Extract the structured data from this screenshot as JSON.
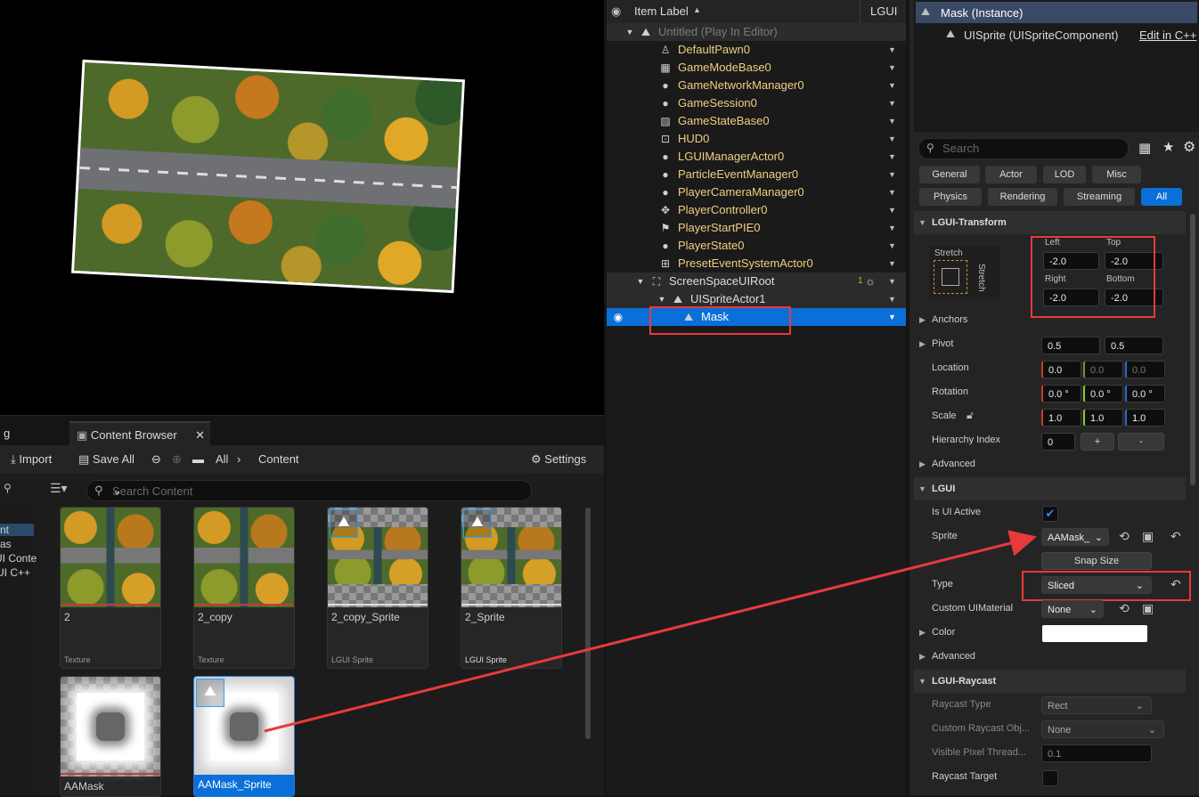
{
  "content_browser": {
    "left_tab": "g",
    "tab_label": "Content Browser",
    "toolbar": {
      "import": "Import",
      "save_all": "Save All",
      "path_all": "All",
      "path_content": "Content",
      "settings": "Settings"
    },
    "search_placeholder": "Search Content",
    "sidebar_items": [
      "nt",
      "as",
      "UI Conte",
      "UI C++"
    ],
    "assets": [
      {
        "name": "2",
        "kind": "Texture"
      },
      {
        "name": "2_copy",
        "kind": "Texture"
      },
      {
        "name": "2_copy_Sprite",
        "kind": "LGUI Sprite"
      },
      {
        "name": "2_Sprite",
        "kind": "LGUI Sprite"
      },
      {
        "name": "AAMask",
        "kind": ""
      },
      {
        "name": "AAMask_Sprite",
        "kind": ""
      }
    ]
  },
  "outliner": {
    "header_label": "Item Label",
    "header_type": "LGUI",
    "rows": [
      {
        "label": "Untitled (Play In Editor)",
        "icon": "level-icon"
      },
      {
        "label": "DefaultPawn0",
        "icon": "pawn-icon"
      },
      {
        "label": "GameModeBase0",
        "icon": "gamemode-icon"
      },
      {
        "label": "GameNetworkManager0",
        "icon": "actor-icon"
      },
      {
        "label": "GameSession0",
        "icon": "actor-icon"
      },
      {
        "label": "GameStateBase0",
        "icon": "gamestate-icon"
      },
      {
        "label": "HUD0",
        "icon": "hud-icon"
      },
      {
        "label": "LGUIManagerActor0",
        "icon": "actor-icon"
      },
      {
        "label": "ParticleEventManager0",
        "icon": "actor-icon"
      },
      {
        "label": "PlayerCameraManager0",
        "icon": "actor-icon"
      },
      {
        "label": "PlayerController0",
        "icon": "controller-icon"
      },
      {
        "label": "PlayerStartPIE0",
        "icon": "playerstart-icon"
      },
      {
        "label": "PlayerState0",
        "icon": "actor-icon"
      },
      {
        "label": "PresetEventSystemActor0",
        "icon": "event-system-icon"
      },
      {
        "label": "ScreenSpaceUIRoot",
        "icon": "ui-root-icon"
      },
      {
        "label": "UISpriteActor1",
        "icon": "sprite-icon"
      },
      {
        "label": "Mask",
        "icon": "sprite-icon"
      }
    ],
    "root_badge": "1"
  },
  "details": {
    "component_root": "Mask (Instance)",
    "component_child": "UISprite (UISpriteComponent)",
    "edit_link": "Edit in C++",
    "search_placeholder": "Search",
    "filters": [
      "General",
      "Actor",
      "LOD",
      "Misc",
      "Physics",
      "Rendering",
      "Streaming",
      "All"
    ],
    "active_filter": "All",
    "sections": {
      "transform": "LGUI-Transform",
      "lgui": "LGUI",
      "raycast": "LGUI-Raycast"
    },
    "anchor_stretch": "Stretch",
    "anchor_stretch_v": "Stretch",
    "offsets": {
      "left_label": "Left",
      "top_label": "Top",
      "right_label": "Right",
      "bottom_label": "Bottom",
      "left": "-2.0",
      "top": "-2.0",
      "right": "-2.0",
      "bottom": "-2.0"
    },
    "anchors": "Anchors",
    "pivot": {
      "label": "Pivot",
      "x": "0.5",
      "y": "0.5"
    },
    "location": {
      "label": "Location",
      "x": "0.0",
      "y": "0.0",
      "z": "0.0"
    },
    "rotation": {
      "label": "Rotation",
      "x": "0.0 °",
      "y": "0.0 °",
      "z": "0.0 °"
    },
    "scale": {
      "label": "Scale",
      "x": "1.0",
      "y": "1.0",
      "z": "1.0"
    },
    "hierarchy": {
      "label": "Hierarchy Index",
      "value": "0",
      "plus": "+",
      "minus": "-"
    },
    "advanced": "Advanced",
    "is_ui_active": "Is UI Active",
    "sprite": {
      "label": "Sprite",
      "value": "AAMask_"
    },
    "snap_size": "Snap Size",
    "type": {
      "label": "Type",
      "value": "Sliced"
    },
    "custom_material": {
      "label": "Custom UIMaterial",
      "value": "None"
    },
    "color": {
      "label": "Color",
      "value": "#ffffff"
    },
    "advanced2": "Advanced",
    "raycast_type": {
      "label": "Raycast Type",
      "value": "Rect"
    },
    "custom_raycast": {
      "label": "Custom Raycast Obj...",
      "value": "None"
    },
    "visible_pixel": {
      "label": "Visible Pixel Thread...",
      "value": "0.1"
    },
    "raycast_target": {
      "label": "Raycast Target"
    }
  },
  "colors": {
    "accent": "#0a6fd8",
    "annotation": "#e83a3a"
  }
}
